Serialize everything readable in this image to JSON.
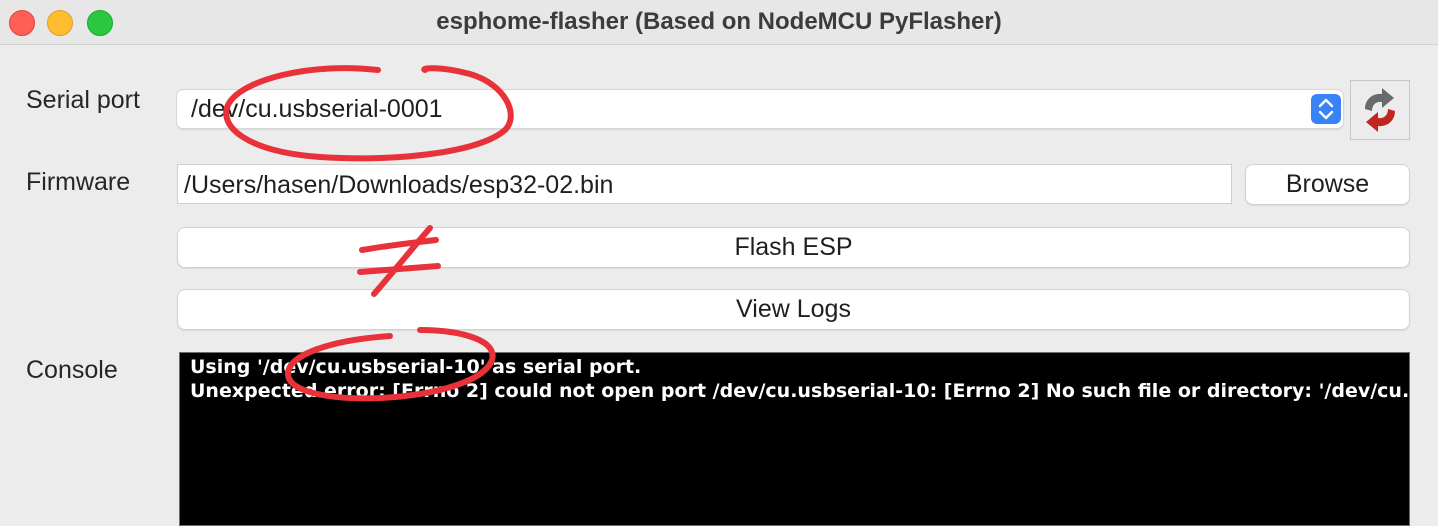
{
  "window": {
    "title": "esphome-flasher (Based on NodeMCU PyFlasher)"
  },
  "form": {
    "serial_port_label": "Serial port",
    "serial_port_value": "/dev/cu.usbserial-0001",
    "firmware_label": "Firmware",
    "firmware_value": "/Users/hasen/Downloads/esp32-02.bin",
    "browse_label": "Browse",
    "flash_label": "Flash ESP",
    "view_logs_label": "View Logs",
    "console_label": "Console"
  },
  "console": {
    "lines": [
      "Using '/dev/cu.usbserial-10' as serial port.",
      "Unexpected error: [Errno 2] could not open port /dev/cu.usbserial-10: [Errno 2] No such file or directory: '/dev/cu.usb"
    ]
  },
  "annotation": {
    "not_equal_symbol": "≠"
  },
  "colors": {
    "accent_blue": "#3a82f7",
    "annotation_red": "#e8323a",
    "refresh_arrow_red": "#c0261f"
  },
  "icons": {
    "refresh": "refresh-arrows-icon",
    "stepper": "chevron-up-down-icon"
  }
}
